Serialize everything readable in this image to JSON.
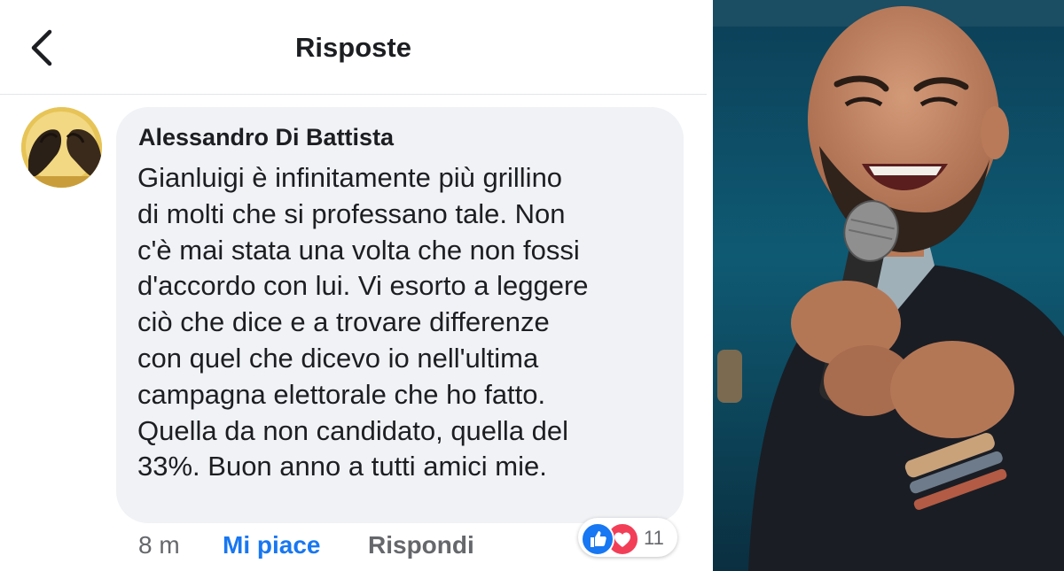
{
  "header": {
    "title": "Risposte",
    "back_icon": "chevron-left-icon"
  },
  "comment": {
    "author": "Alessandro Di Battista",
    "text": "Gianluigi è infinitamente più grillino\ndi molti che si professano tale. Non\nc'è mai stata una volta che non fossi\nd'accordo con lui. Vi esorto a leggere\nciò che dice e a trovare differenze\ncon quel che dicevo io nell'ultima\ncampagna elettorale che ho fatto.\nQuella da non candidato, quella del\n33%. Buon anno a tutti amici mie.",
    "time": "8 m",
    "like_label": "Mi piace",
    "reply_label": "Rispondi",
    "reaction_count": "11",
    "reaction_icons": [
      "like-icon",
      "love-icon"
    ]
  },
  "colors": {
    "facebook_blue": "#1877f2",
    "love_red": "#f33e58",
    "bubble_bg": "#f0f2f5",
    "secondary_text": "#65676b"
  }
}
